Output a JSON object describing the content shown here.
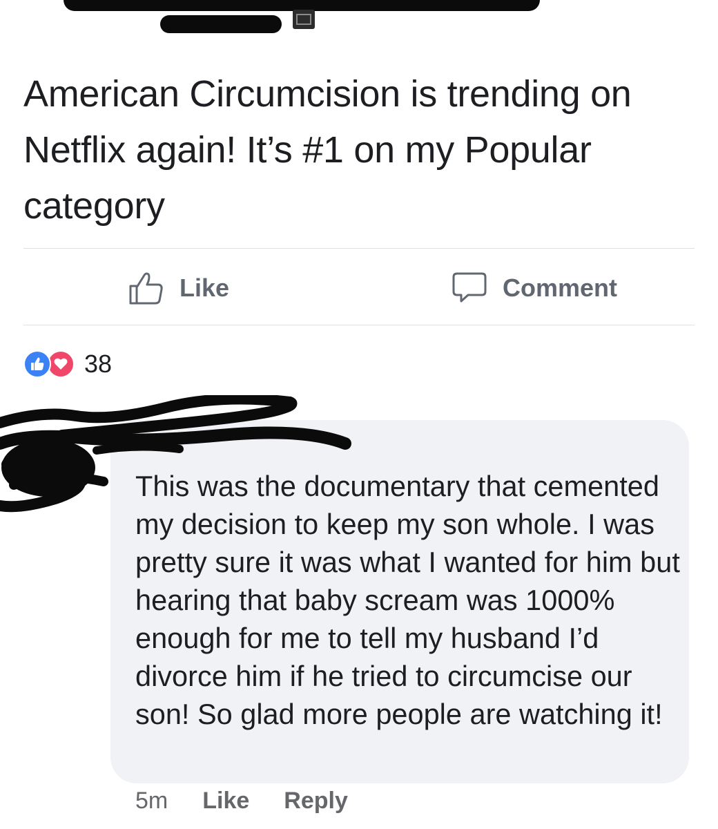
{
  "post": {
    "text": "American Circumcision is trending on Netflix again! It’s #1 on my Popular category"
  },
  "actions": {
    "like_label": "Like",
    "comment_label": "Comment"
  },
  "reactions": {
    "count": "38",
    "types": [
      "like-icon",
      "love-icon"
    ]
  },
  "comment": {
    "text": "This was the documentary that cemented my decision to keep my son whole. I was pretty sure it was what I wanted for him but hearing that baby scream was 1000% enough for me to tell my husband I’d divorce him if he tried to circumcise our son! So glad more people are watching it!",
    "time": "5m",
    "like_label": "Like",
    "reply_label": "Reply"
  },
  "colors": {
    "text": "#1c1e21",
    "secondary": "#606770",
    "like_blue": "#3b82f6",
    "love_red": "#f0466a",
    "bubble": "#f0f2f5",
    "divider": "#dddfe2"
  }
}
